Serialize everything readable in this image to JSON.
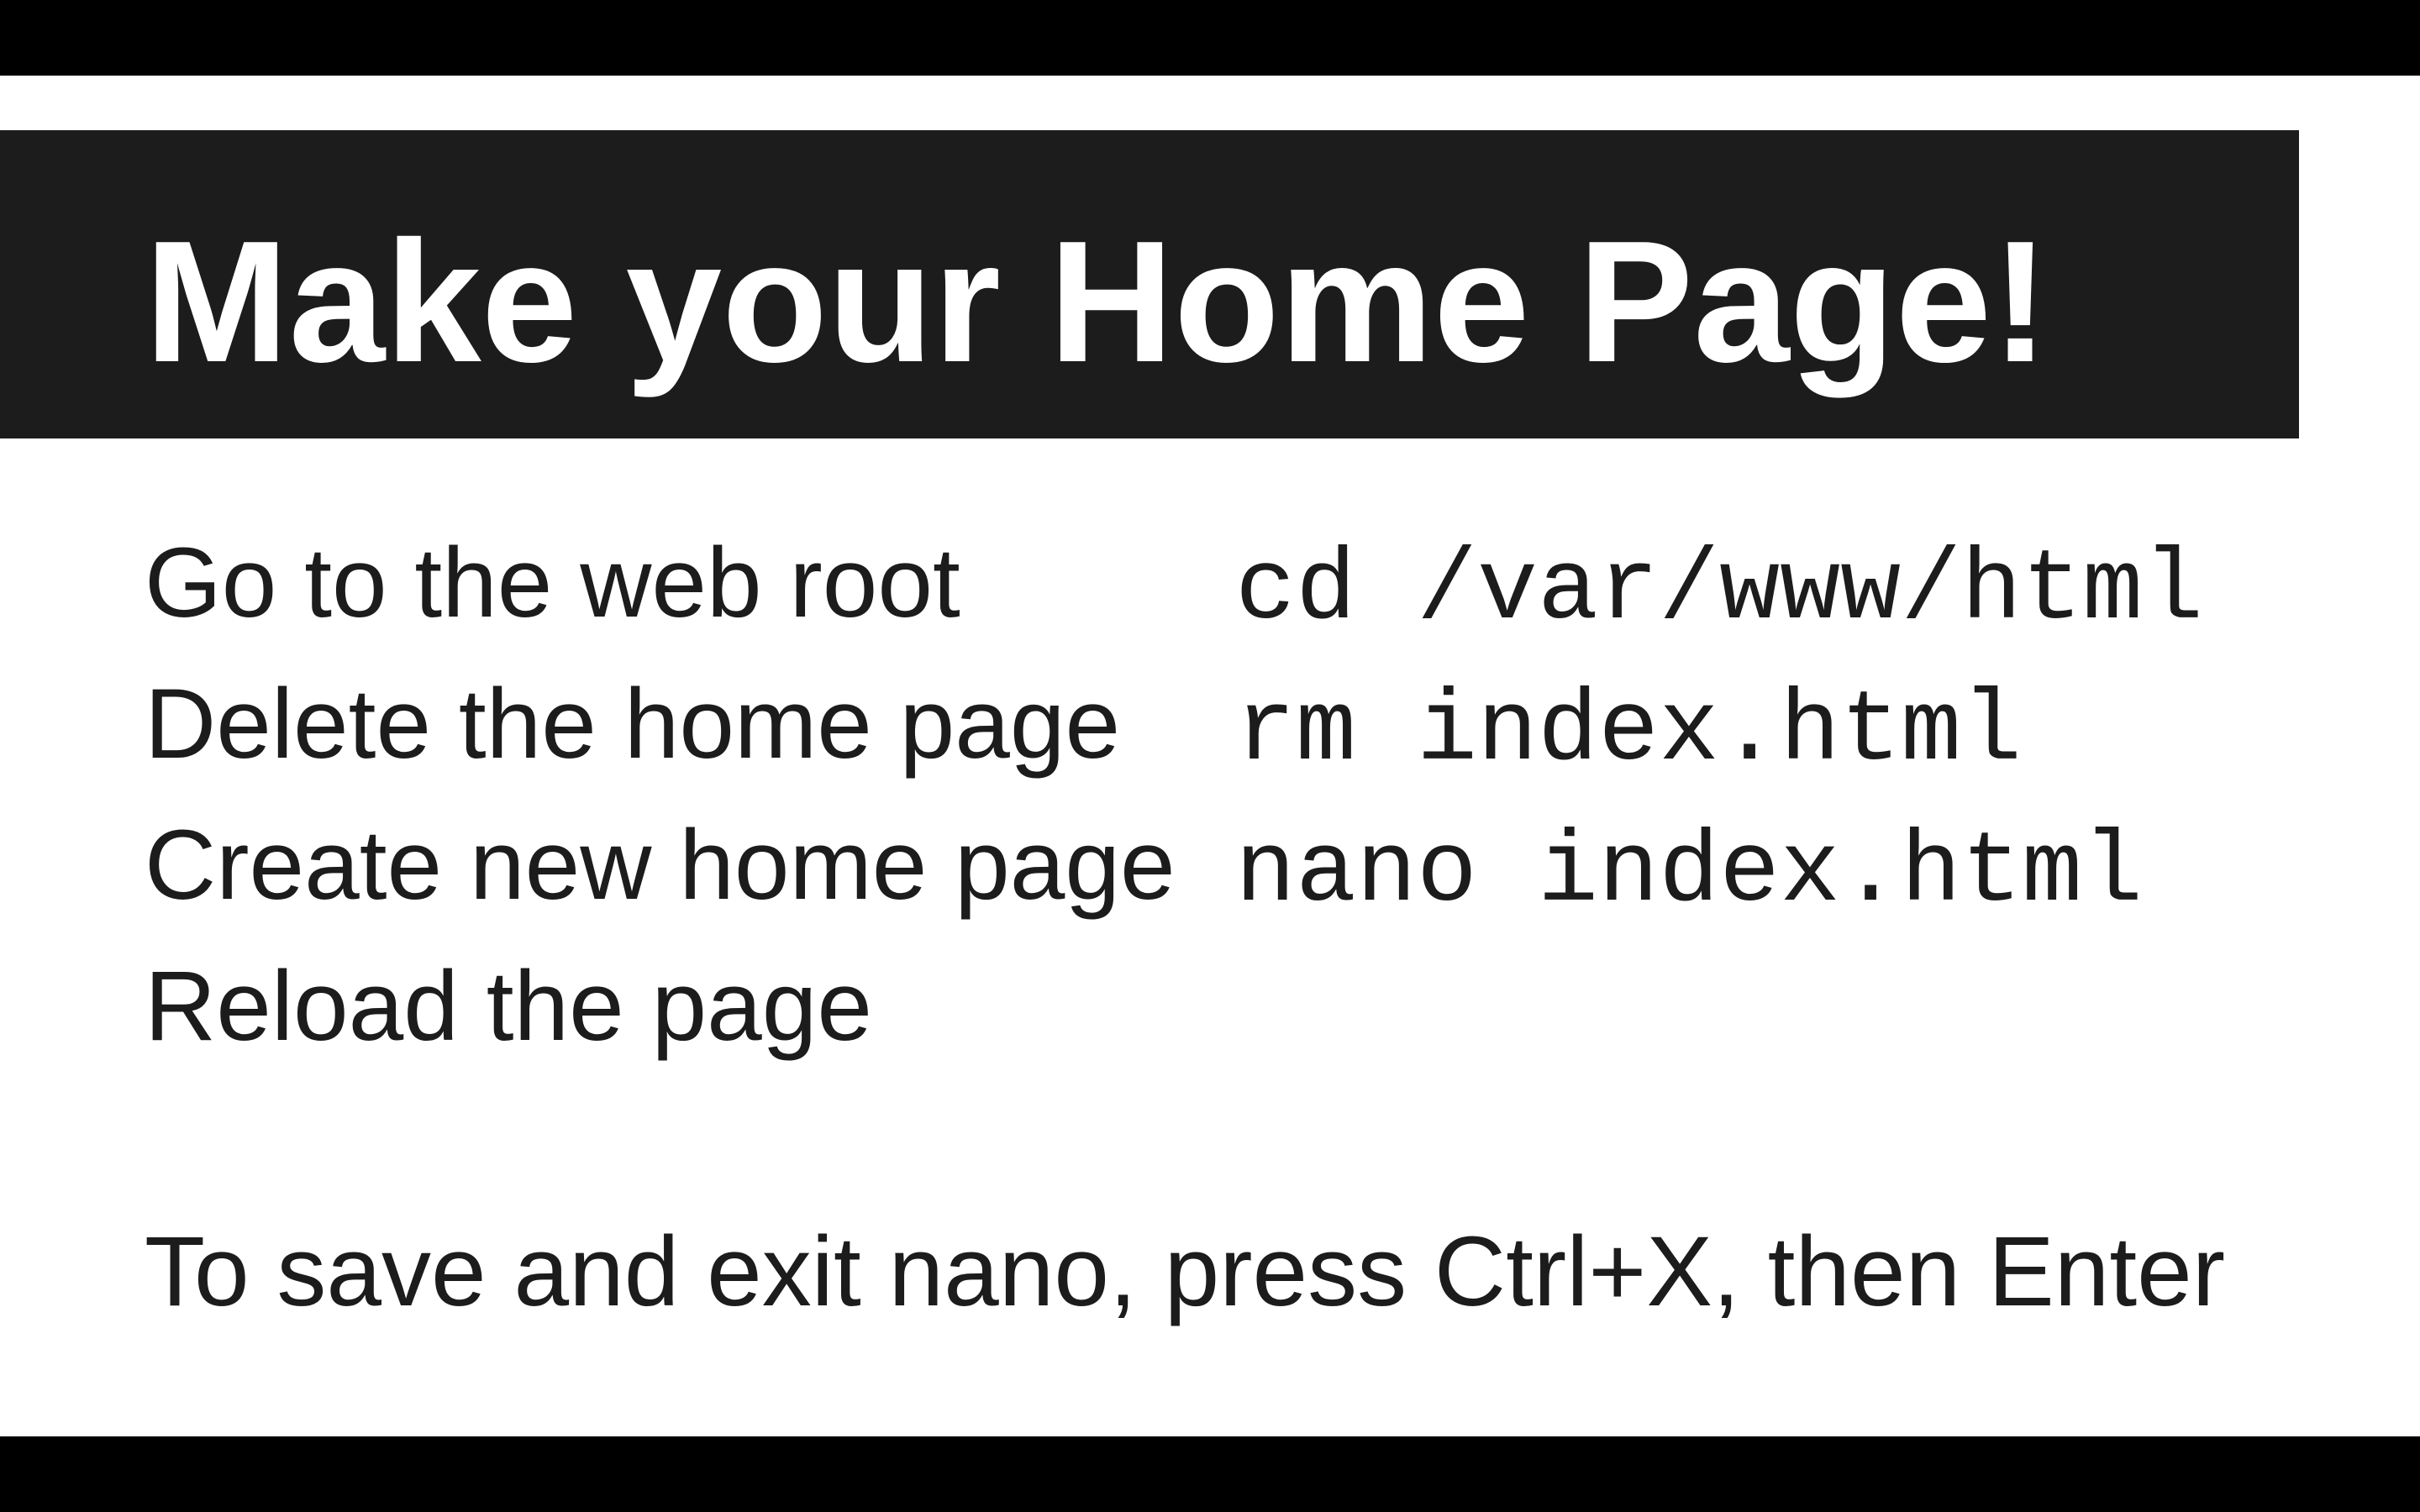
{
  "slide": {
    "title": "Make your Home Page!",
    "steps": [
      {
        "label": "Go to the web root",
        "command": "cd /var/www/html"
      },
      {
        "label": "Delete the home page",
        "command": "rm index.html"
      },
      {
        "label": "Create new home page",
        "command": "nano index.html"
      },
      {
        "label": "Reload the page",
        "command": ""
      }
    ],
    "note": "To save and exit nano, press Ctrl+X, then Enter"
  },
  "colors": {
    "letterbox": "#000000",
    "title_bar": "#1c1c1c",
    "title_text": "#ffffff",
    "body_text": "#1c1c1c",
    "slide_background": "#ffffff"
  }
}
